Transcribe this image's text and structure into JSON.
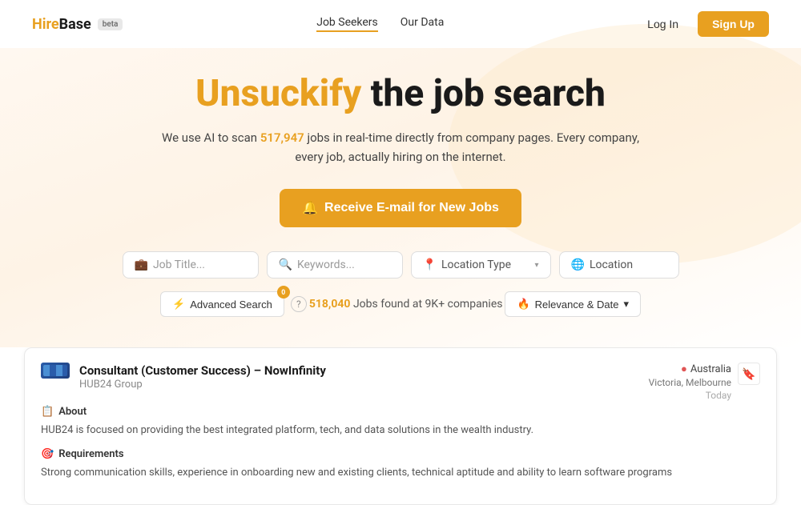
{
  "navbar": {
    "logo_hire": "Hire",
    "logo_base": "Base",
    "beta_label": "beta",
    "nav_links": [
      {
        "label": "Job Seekers",
        "active": true
      },
      {
        "label": "Our Data",
        "active": false
      }
    ],
    "login_label": "Log In",
    "signup_label": "Sign Up"
  },
  "hero": {
    "title_orange": "Unsuckify",
    "title_dark": " the job search",
    "subtitle_pre": "We use AI to scan ",
    "subtitle_count": "517,947",
    "subtitle_post": " jobs in real-time directly from company pages. Every company, every job, actually hiring on the internet.",
    "cta_icon": "🔔",
    "cta_label": "Receive E-mail for New Jobs"
  },
  "search": {
    "job_title_icon": "💼",
    "job_title_placeholder": "Job Title...",
    "keywords_icon": "🔍",
    "keywords_placeholder": "Keywords...",
    "location_type_icon": "📍",
    "location_type_label": "Location Type",
    "location_icon": "🌐",
    "location_placeholder": "Location"
  },
  "filters": {
    "advanced_icon": "⚡",
    "advanced_label": "Advanced Search",
    "advanced_badge": "0",
    "help_icon": "?",
    "results_count": "518,040",
    "results_suffix": " Jobs found at 9K+ companies",
    "sort_icon": "🔥",
    "sort_label": "Relevance & Date",
    "sort_chevron": "▾"
  },
  "job_card": {
    "title": "Consultant (Customer Success) – NowInfinity",
    "company": "HUB24 Group",
    "country_flag": "🔴",
    "country": "Australia",
    "city": "Victoria, Melbourne",
    "date": "Today",
    "about_icon": "📋",
    "about_label": "About",
    "about_text": "HUB24 is focused on providing the best integrated platform, tech, and data solutions in the wealth industry.",
    "requirements_icon": "🎯",
    "requirements_label": "Requirements",
    "requirements_text": "Strong communication skills, experience in onboarding new and existing clients, technical aptitude and ability to learn software programs"
  }
}
